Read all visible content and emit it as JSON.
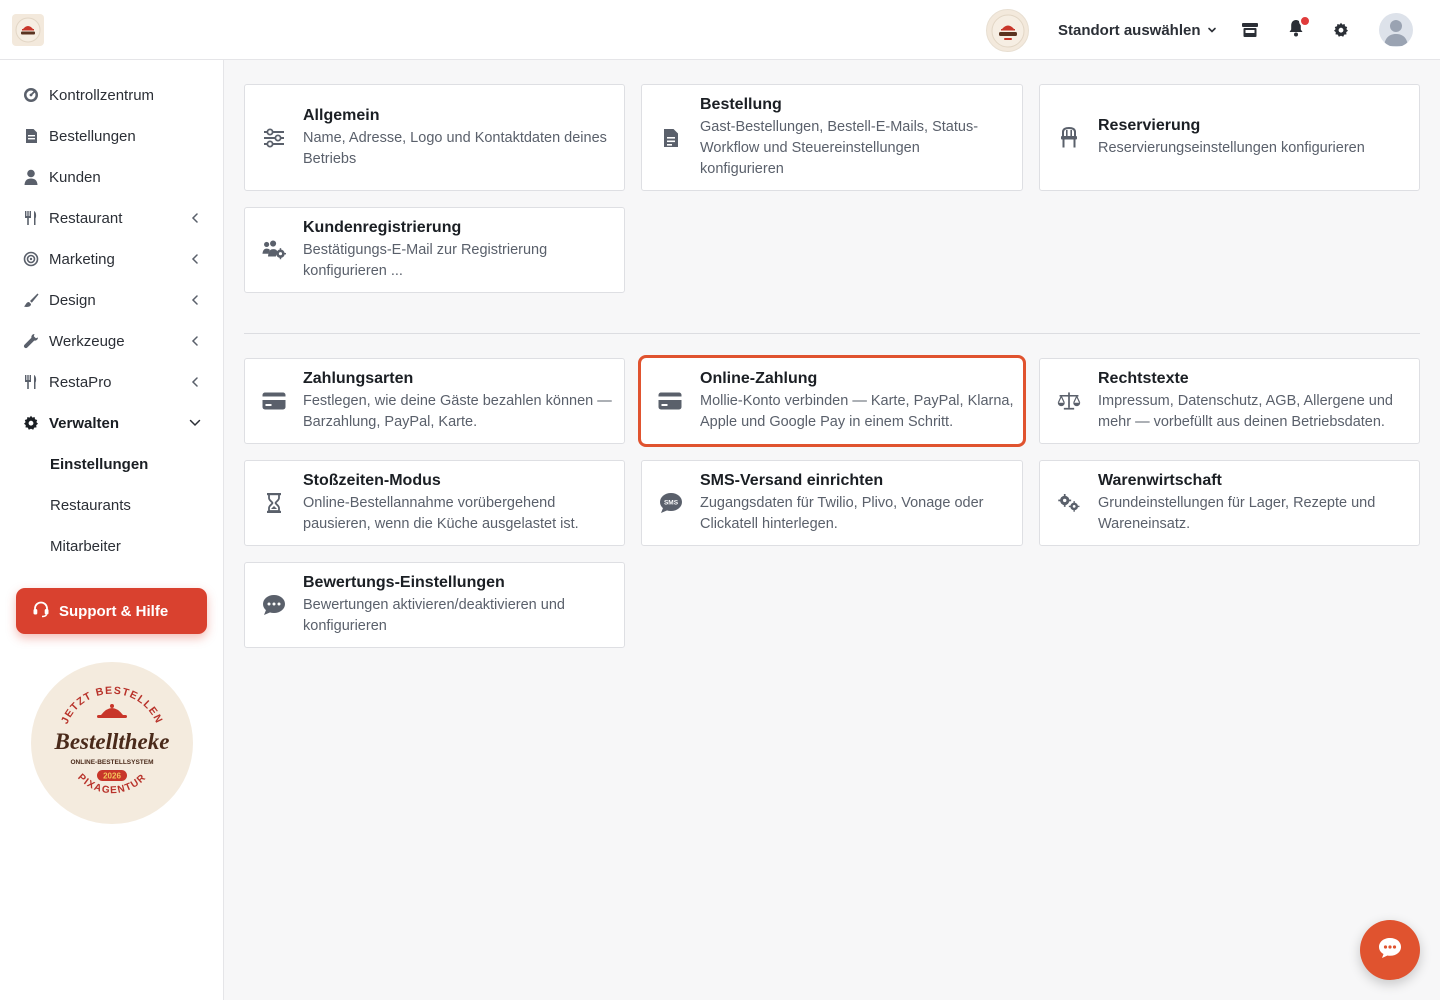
{
  "header": {
    "location_select_label": "Standort auswählen",
    "icons": [
      "store-icon",
      "bell-icon",
      "gear-icon",
      "user-avatar-icon"
    ]
  },
  "sidebar": {
    "items": [
      {
        "label": "Kontrollzentrum",
        "icon": "dashboard-icon"
      },
      {
        "label": "Bestellungen",
        "icon": "receipt-icon"
      },
      {
        "label": "Kunden",
        "icon": "user-icon"
      },
      {
        "label": "Restaurant",
        "icon": "utensils-icon"
      },
      {
        "label": "Marketing",
        "icon": "target-icon"
      },
      {
        "label": "Design",
        "icon": "brush-icon"
      },
      {
        "label": "Werkzeuge",
        "icon": "wrench-icon"
      },
      {
        "label": "RestaPro",
        "icon": "utensils-icon"
      },
      {
        "label": "Verwalten",
        "icon": "gear-icon"
      }
    ],
    "subitems": [
      {
        "label": "Einstellungen"
      },
      {
        "label": "Restaurants"
      },
      {
        "label": "Mitarbeiter"
      }
    ],
    "support_label": "Support & Hilfe",
    "seal": {
      "top_text": "JETZT BESTELLEN",
      "brand": "Bestelltheke",
      "subtitle": "ONLINE-BESTELLSYSTEM",
      "year": "2026",
      "bottom_text": "PIXAGENTUR"
    }
  },
  "cards": [
    {
      "title": "Allgemein",
      "desc": "Name, Adresse, Logo und Kontaktdaten deines Betriebs",
      "icon": "sliders-icon"
    },
    {
      "title": "Bestellung",
      "desc": "Gast-Bestellungen, Bestell-E-Mails, Status-Workflow und Steuereinstellungen konfigurieren",
      "icon": "document-icon"
    },
    {
      "title": "Reservierung",
      "desc": "Reservierungseinstellungen konfigurieren",
      "icon": "chair-icon"
    },
    {
      "title": "Kundenregistrierung",
      "desc": "Bestätigungs-E-Mail zur Registrierung konfigurieren ...",
      "icon": "users-gear-icon"
    },
    {
      "title": "Zahlungsarten",
      "desc": "Festlegen, wie deine Gäste bezahlen können — Barzahlung, PayPal, Karte.",
      "icon": "credit-card-icon"
    },
    {
      "title": "Online-Zahlung",
      "desc": "Mollie-Konto verbinden — Karte, PayPal, Klarna, Apple und Google Pay in einem Schritt.",
      "icon": "credit-card-icon"
    },
    {
      "title": "Rechtstexte",
      "desc": "Impressum, Datenschutz, AGB, Allergene und mehr — vorbefüllt aus deinen Betriebsdaten.",
      "icon": "scale-icon"
    },
    {
      "title": "Stoßzeiten-Modus",
      "desc": "Online-Bestellannahme vorübergehend pausieren, wenn die Küche ausgelastet ist.",
      "icon": "hourglass-icon"
    },
    {
      "title": "SMS-Versand einrichten",
      "desc": "Zugangsdaten für Twilio, Plivo, Vonage oder Clickatell hinterlegen.",
      "icon": "sms-icon"
    },
    {
      "title": "Warenwirtschaft",
      "desc": "Grundeinstellungen für Lager, Rezepte und Wareneinsatz.",
      "icon": "gears-icon"
    },
    {
      "title": "Bewertungs-Einstellungen",
      "desc": "Bewertungen aktivieren/deaktivieren und konfigurieren",
      "icon": "chat-bubble-icon"
    }
  ],
  "sms_icon_text": "SMS",
  "colors": {
    "accent": "#d9412f",
    "highlight_border": "#e0532f",
    "notification": "#e03b3b"
  }
}
